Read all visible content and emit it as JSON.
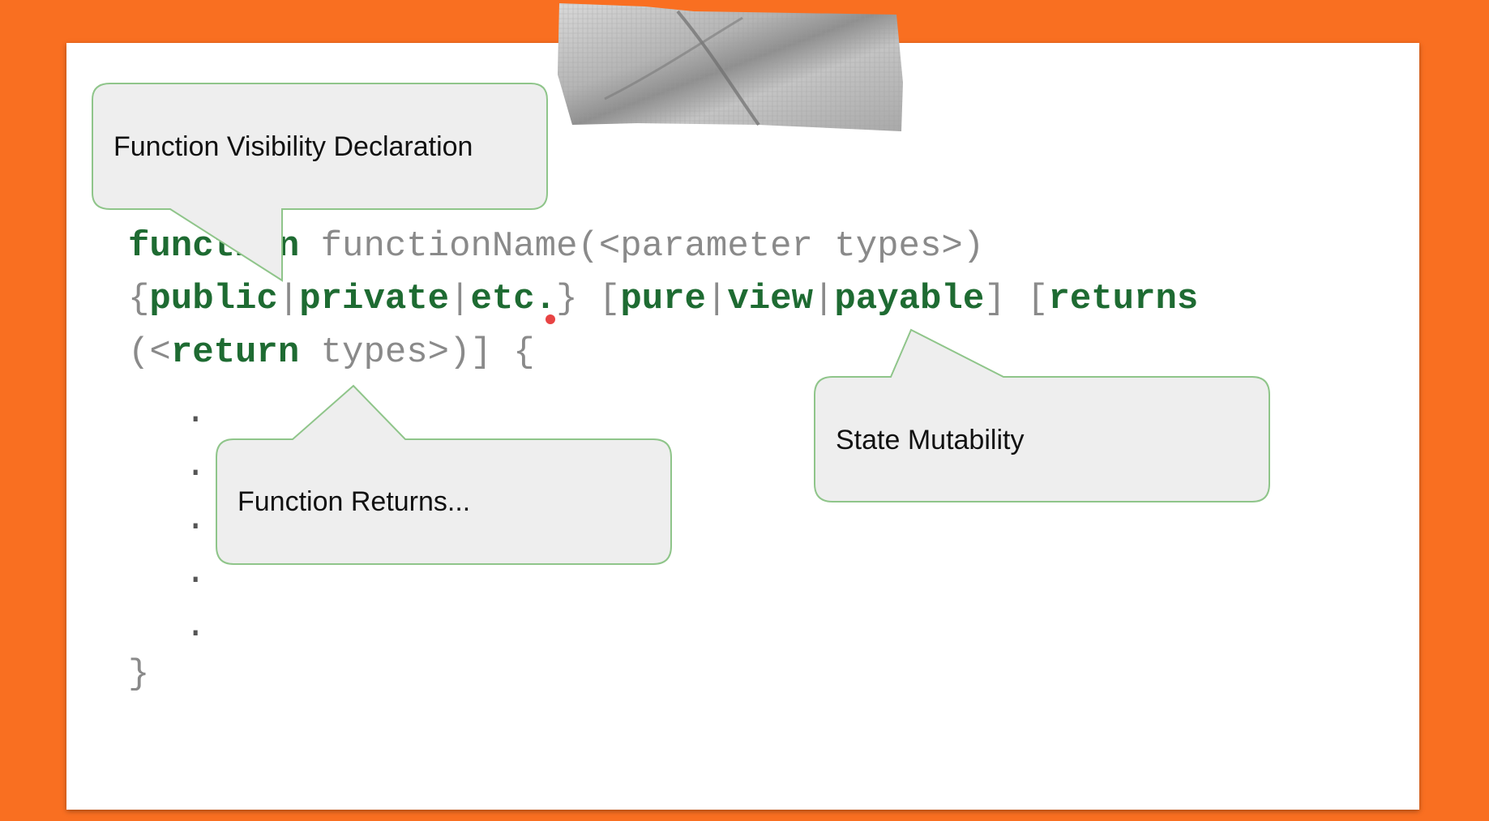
{
  "colors": {
    "background": "#f96f21",
    "slide": "#ffffff",
    "keyword": "#1e6b32",
    "code_text": "#8a8a8a",
    "callout_fill": "#eeeeee",
    "callout_border": "#8fc58a"
  },
  "callouts": {
    "visibility": "Function Visibility Declaration",
    "returns": "Function Returns...",
    "mutability": "State Mutability"
  },
  "code": {
    "line1": {
      "kw_function": "function",
      "name": " functionName(<parameter types>)"
    },
    "line2": {
      "brace_open": "{",
      "kw_public": "public",
      "sep1": "|",
      "kw_private": "private",
      "sep2": "|",
      "kw_etc": "etc.",
      "brace_close_bracket": "} [",
      "kw_pure": "pure",
      "sep3": "|",
      "kw_view": "view",
      "sep4": "|",
      "kw_payable": "payable",
      "bracket_close_open": "] [",
      "kw_returns": "returns"
    },
    "line3": {
      "paren_open": "(<",
      "kw_return": "return",
      "rest": " types>)] {"
    },
    "body_dot": ".",
    "closing_brace": "}"
  }
}
